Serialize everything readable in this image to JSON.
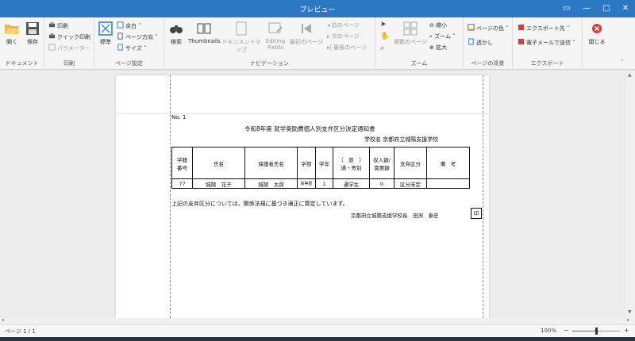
{
  "window": {
    "title": "プレビュー",
    "btn_restore": "▭",
    "btn_minimize": "—",
    "btn_maximize": "□",
    "btn_close": "✕"
  },
  "ribbon": {
    "document": {
      "label": "ドキュメント",
      "open": "開く",
      "save": "保存"
    },
    "print": {
      "label": "印刷",
      "print": "印刷",
      "quick_print": "クイック印刷",
      "parameters": "パラメーター"
    },
    "page_setup": {
      "label": "ページ設定",
      "scale": "標準",
      "margins": "余白",
      "orientation": "ページ方向",
      "size": "サイズ"
    },
    "navigation": {
      "label": "ナビゲーション",
      "search": "検索",
      "thumbnails": "Thumbnails",
      "doc_map": "ドキュメントマップ",
      "editing_fields_1": "Editing",
      "editing_fields_2": "Fields",
      "first_page": "最初のページ",
      "prev_page": "前のページ",
      "next_page": "次のページ",
      "last_page": "最後のページ"
    },
    "zoom": {
      "label": "ズーム",
      "multi_page": "複数のページ",
      "zoom_out": "縮小",
      "zoom": "ズーム",
      "zoom_in": "拡大"
    },
    "background": {
      "label": "ページの背景",
      "page_color": "ページの色",
      "watermark": "透かし"
    },
    "export": {
      "label": "エクスポート",
      "export_to": "エクスポート先",
      "email_as": "電子メールで送信"
    },
    "close": {
      "label": "閉じる"
    }
  },
  "document": {
    "number": "No. 1",
    "title": "令和8年度 就学奨励費個人別支弁区分決定通知書",
    "school_line": "学校名 京都府立城陽支援学校",
    "headers": {
      "student_no_1": "学籍",
      "student_no_2": "番号",
      "name": "氏名",
      "guardian": "保護者氏名",
      "dept": "学部",
      "grade": "学年",
      "commute_1": "（　旅　）",
      "commute_2": "通・寄別",
      "income_1": "収入額/",
      "income_2": "需要額",
      "category": "支弁区分",
      "remarks": "備　考"
    },
    "row": {
      "student_no": "77",
      "name": "城陽　花子",
      "guardian": "城陽　太郎",
      "dept": "高等部",
      "grade": "1",
      "commute": "通学生",
      "income": "0",
      "category": "区分未定",
      "remarks": ""
    },
    "note": "上記の支弁区分については、関係法規に基づき適正に算定しています。",
    "signer": "京都府立城陽支援学校長　田渕　泰史",
    "seal": "印"
  },
  "status": {
    "page": "ページ 1 / 1",
    "zoom": "100%",
    "zoom_level": 0.5,
    "zoom_minus": "−",
    "zoom_plus": "+"
  },
  "icons": {
    "open": "folder-open-icon",
    "save": "save-icon",
    "print": "printer-icon",
    "search": "binoculars-icon",
    "close": "close-circle-icon"
  },
  "colors": {
    "titlebar": "#2b78c5",
    "ribbon_bg": "#f5f5f5",
    "accent": "#2b78c5",
    "close_red": "#d83b3b"
  }
}
